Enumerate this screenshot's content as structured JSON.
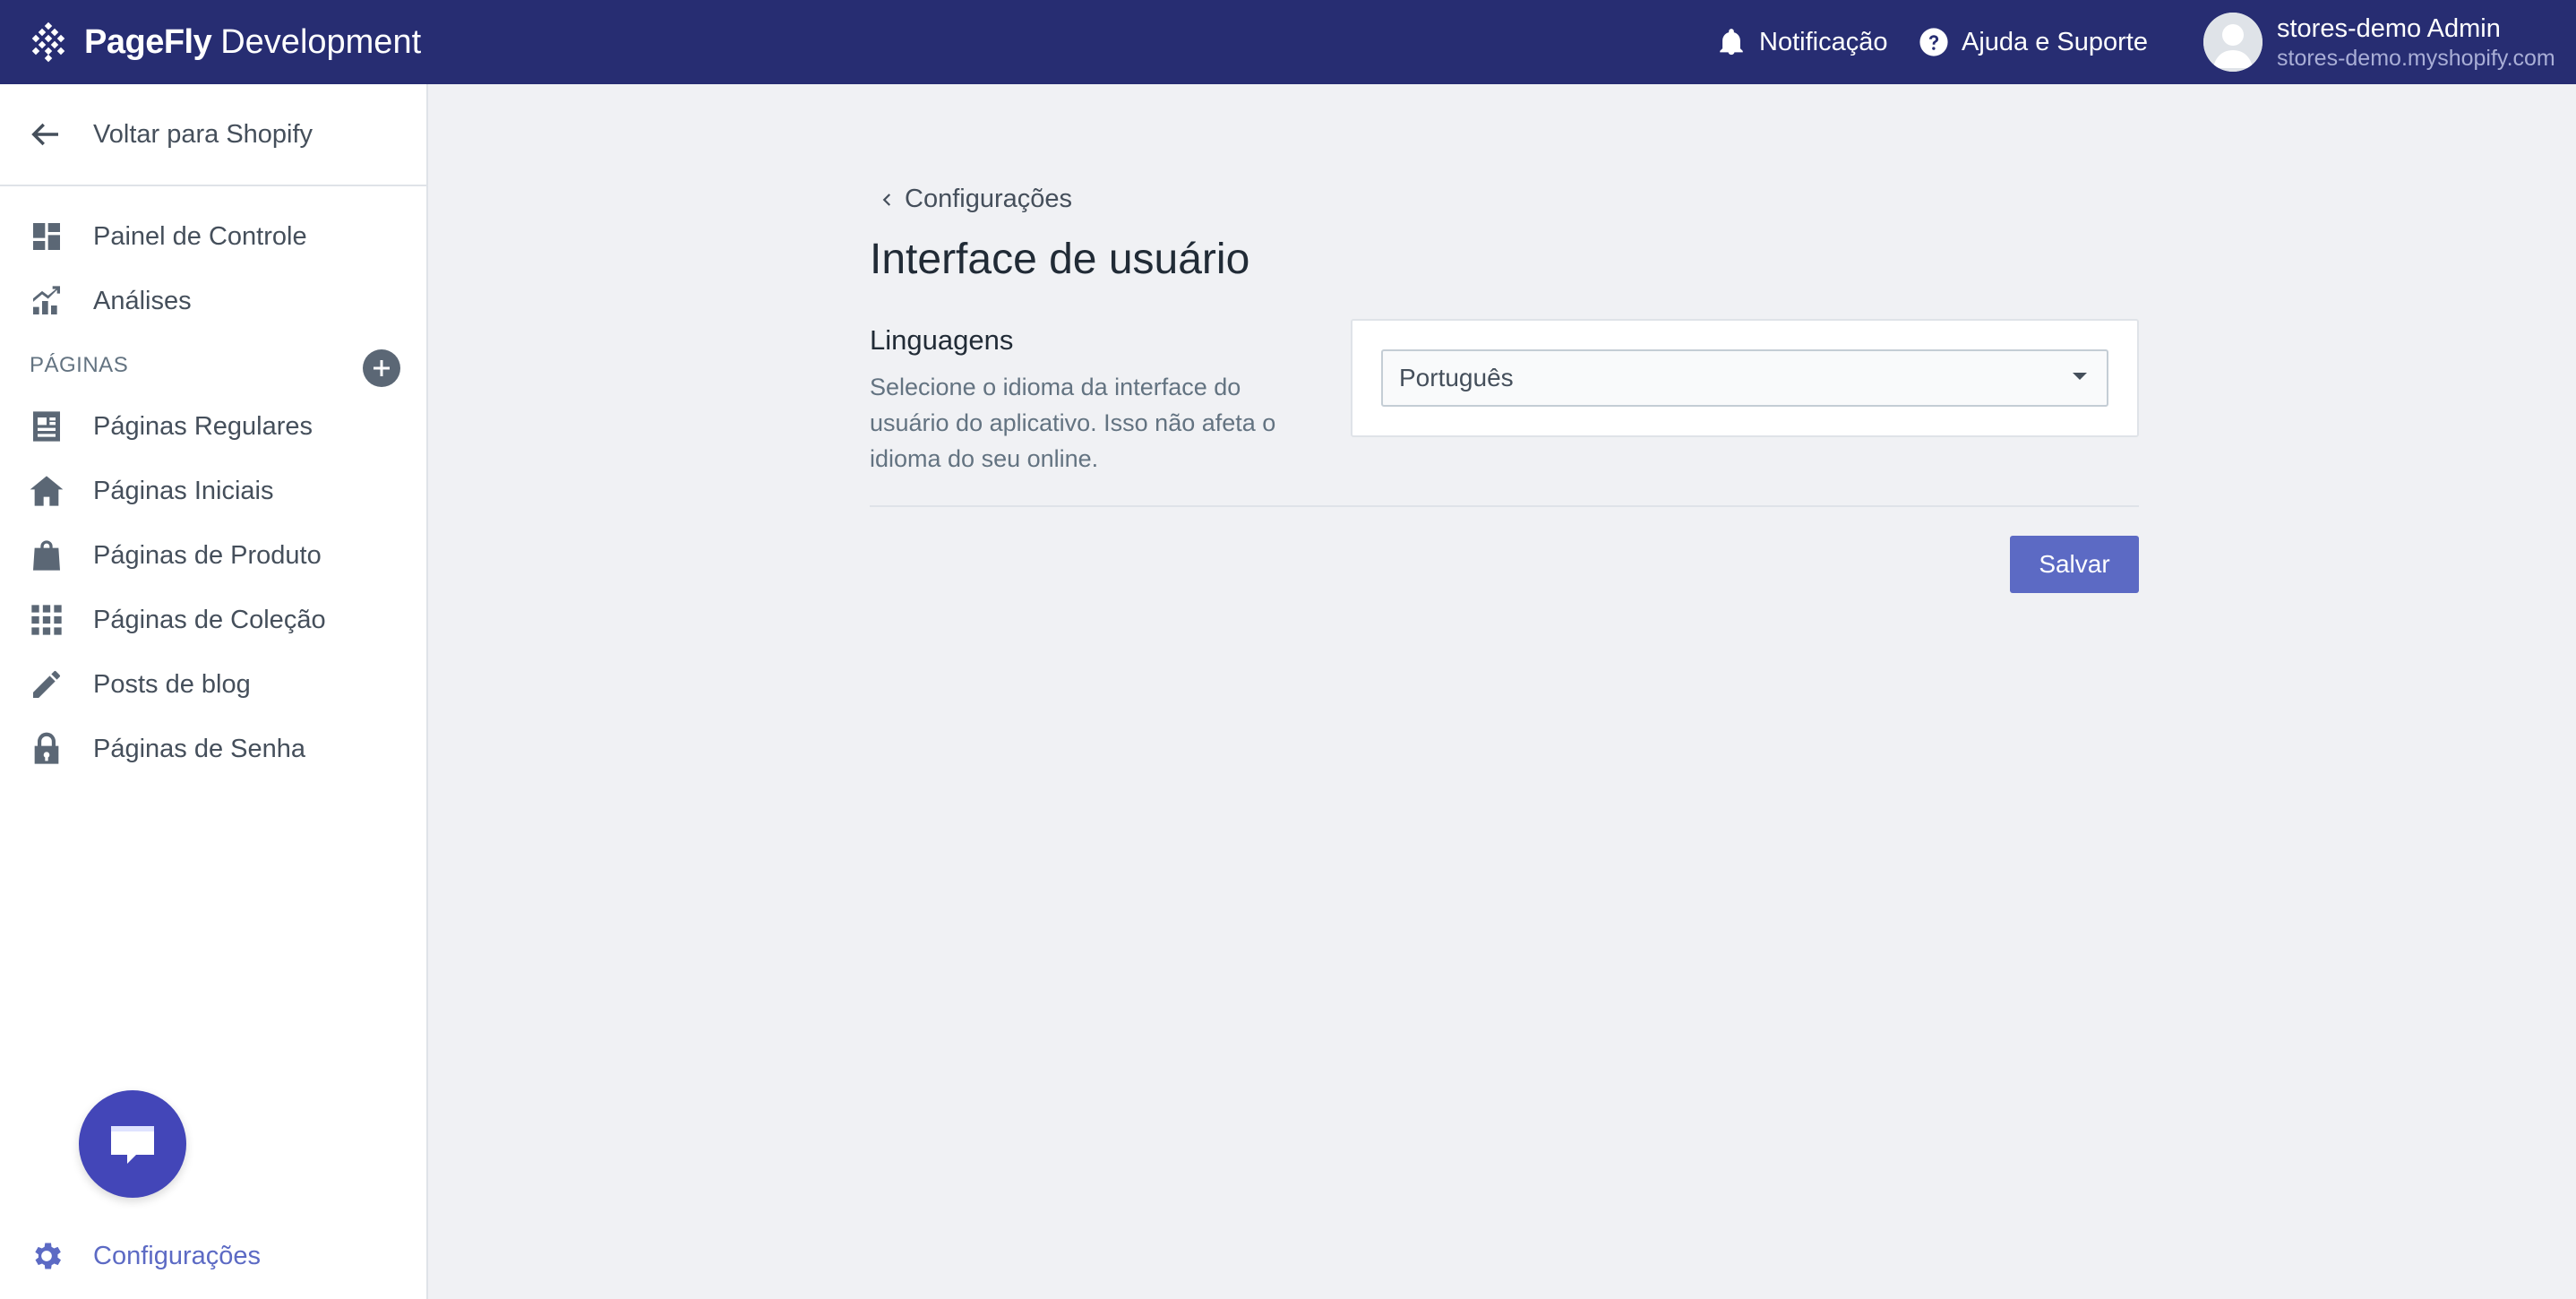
{
  "header": {
    "brand_name": "PageFly",
    "brand_env": "Development",
    "notification_label": "Notificação",
    "help_label": "Ajuda e Suporte",
    "user_name": "stores-demo Admin",
    "user_shop": "stores-demo.myshopify.com",
    "background_color": "#272d72"
  },
  "sidebar": {
    "back_label": "Voltar para Shopify",
    "top_items": [
      {
        "label": "Painel de Controle",
        "icon": "dashboard-icon"
      },
      {
        "label": "Análises",
        "icon": "analytics-icon"
      }
    ],
    "section_title": "PÁGINAS",
    "page_items": [
      {
        "label": "Páginas Regulares",
        "icon": "regular-page-icon"
      },
      {
        "label": "Páginas Iniciais",
        "icon": "home-icon"
      },
      {
        "label": "Páginas de Produto",
        "icon": "shopping-bag-icon"
      },
      {
        "label": "Páginas de Coleção",
        "icon": "grid-icon"
      },
      {
        "label": "Posts de blog",
        "icon": "pencil-icon"
      },
      {
        "label": "Páginas de Senha",
        "icon": "lock-icon"
      }
    ],
    "settings_label": "Configurações",
    "accent_color": "#5c6ac4"
  },
  "main": {
    "breadcrumb": "Configurações",
    "title": "Interface de usuário",
    "section_title": "Linguagens",
    "section_description": "Selecione o idioma da interface do usuário do aplicativo. Isso não afeta o idioma do seu online.",
    "language_selected": "Português",
    "save_label": "Salvar"
  }
}
